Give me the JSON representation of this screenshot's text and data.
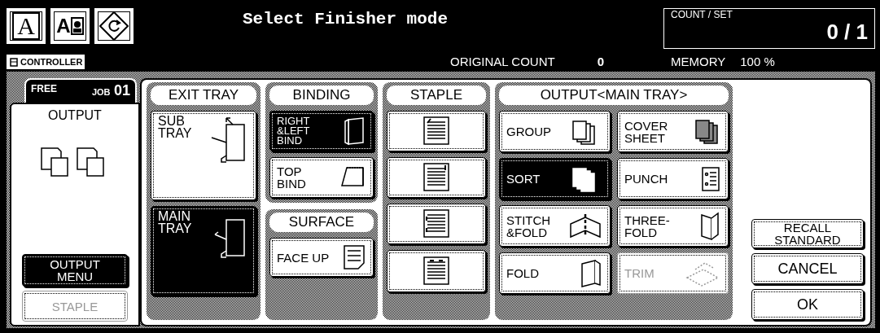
{
  "header": {
    "mode_buttons": [
      {
        "kind": "text",
        "glyph": "A",
        "selected": false
      },
      {
        "kind": "text_image",
        "glyph": "A",
        "selected": false
      },
      {
        "kind": "rotate",
        "selected": false
      }
    ],
    "title": "Select Finisher mode",
    "count_set": {
      "label": "COUNT / SET",
      "value": "0 / 1"
    },
    "controller": "CONTROLLER",
    "original_count": {
      "label": "ORIGINAL COUNT",
      "value": "0"
    },
    "memory": {
      "label": "MEMORY",
      "value": "100 %"
    }
  },
  "job_tab": {
    "free": "FREE",
    "job": "JOB",
    "number": "01"
  },
  "output_panel": {
    "legend": "OUTPUT",
    "buttons": [
      {
        "lines": [
          "OUTPUT",
          "MENU"
        ],
        "selected": true,
        "disabled": false
      },
      {
        "lines": [
          "STAPLE"
        ],
        "selected": false,
        "disabled": true
      }
    ]
  },
  "groups": [
    {
      "title": "EXIT TRAY",
      "buttons": [
        {
          "lines": [
            "SUB",
            "TRAY"
          ],
          "selected": false,
          "disabled": false
        },
        {
          "lines": [
            "MAIN",
            "TRAY"
          ],
          "selected": true,
          "disabled": false
        }
      ]
    },
    {
      "title": "BINDING",
      "buttons": [
        {
          "lines": [
            "RIGHT",
            "&LEFT",
            "BIND"
          ],
          "selected": true,
          "disabled": false
        },
        {
          "lines": [
            "TOP",
            "BIND"
          ],
          "selected": false,
          "disabled": false
        }
      ]
    },
    {
      "title": "SURFACE",
      "buttons": [
        {
          "lines": [
            "FACE UP"
          ],
          "selected": false,
          "disabled": false
        }
      ]
    },
    {
      "title": "STAPLE",
      "buttons": [
        {
          "selected": false,
          "disabled": false
        },
        {
          "selected": false,
          "disabled": false
        },
        {
          "selected": false,
          "disabled": false
        },
        {
          "selected": false,
          "disabled": false
        }
      ]
    },
    {
      "title": "OUTPUT<MAIN TRAY>",
      "buttons": [
        {
          "lines": [
            "GROUP"
          ],
          "selected": false,
          "disabled": false
        },
        {
          "lines": [
            "COVER",
            "SHEET"
          ],
          "selected": false,
          "disabled": false
        },
        {
          "lines": [
            "SORT"
          ],
          "selected": true,
          "disabled": false
        },
        {
          "lines": [
            "PUNCH"
          ],
          "selected": false,
          "disabled": false
        },
        {
          "lines": [
            "STITCH",
            "&FOLD"
          ],
          "selected": false,
          "disabled": false
        },
        {
          "lines": [
            "THREE-",
            "FOLD"
          ],
          "selected": false,
          "disabled": false
        },
        {
          "lines": [
            "FOLD"
          ],
          "selected": false,
          "disabled": false
        },
        {
          "lines": [
            "TRIM"
          ],
          "selected": false,
          "disabled": true
        }
      ]
    }
  ],
  "actions": [
    {
      "lines": [
        "RECALL",
        "STANDARD"
      ],
      "selected": false,
      "disabled": false
    },
    {
      "lines": [
        "CANCEL"
      ],
      "selected": false,
      "disabled": false
    },
    {
      "lines": [
        "OK"
      ],
      "selected": false,
      "disabled": false
    }
  ]
}
